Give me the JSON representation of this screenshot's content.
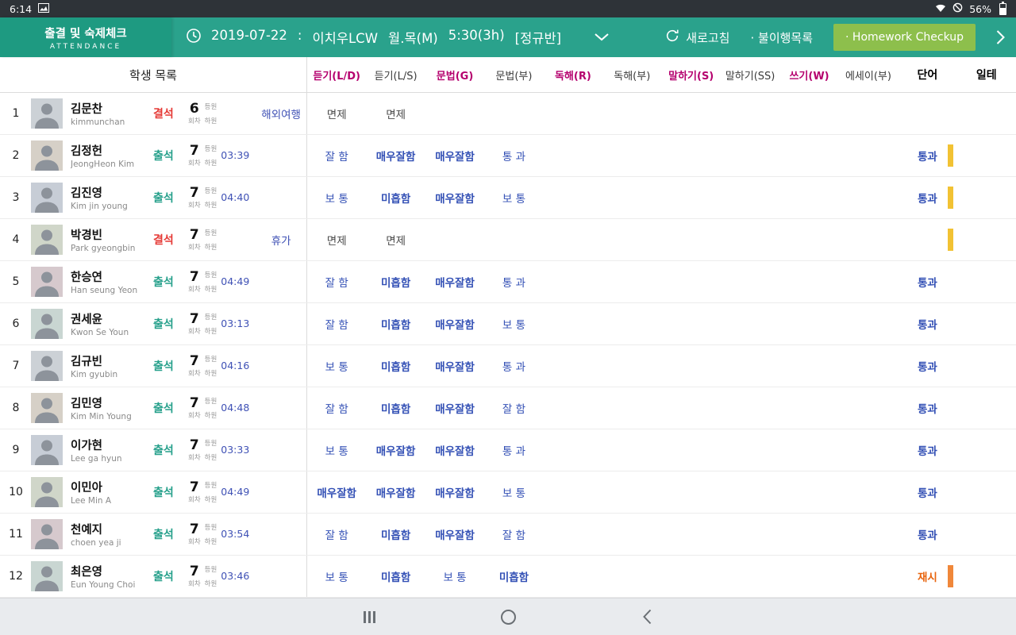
{
  "colors": {
    "header_teal": "#2aa28c",
    "header_teal_dark": "#1e9a81",
    "column_accent_magenta": "#b5006e",
    "grade_value_blue": "#3350b5",
    "present_teal": "#26a08b",
    "absent_red": "#e53935",
    "retry_orange": "#e8650f",
    "indicator_yellow": "#f2c233",
    "indicator_orange": "#f0873a",
    "homework_button_green": "#8dbf4c"
  },
  "status_bar": {
    "time": "6:14",
    "battery_percent": "56%"
  },
  "header": {
    "title": "출결 및 숙제체크",
    "subtitle": "ATTENDANCE",
    "session_parts": [
      "2019-07-22",
      ":",
      "이치우LCW",
      "월.목(M)",
      "5:30(3h)",
      "[정규반]"
    ],
    "refresh_label": "새로고침",
    "noncompliance_label": "· 불이행목록",
    "homework_button_label": "· Homework Checkup"
  },
  "table": {
    "student_list_header": "학생 목록",
    "count_unit": "회차",
    "in_label": "등원",
    "out_label": "하원",
    "columns": [
      {
        "label": "듣기(L/D)",
        "style": "accent"
      },
      {
        "label": "듣기(L/S)",
        "style": "muted"
      },
      {
        "label": "문법(G)",
        "style": "accent"
      },
      {
        "label": "문법(부)",
        "style": "muted"
      },
      {
        "label": "독해(R)",
        "style": "accent"
      },
      {
        "label": "독해(부)",
        "style": "muted"
      },
      {
        "label": "말하기(S)",
        "style": "accent"
      },
      {
        "label": "말하기(SS)",
        "style": "muted"
      },
      {
        "label": "쓰기(W)",
        "style": "accent"
      },
      {
        "label": "에세이(부)",
        "style": "muted"
      },
      {
        "label": "단어",
        "style": "strong"
      },
      {
        "label": "일테",
        "style": "strong"
      }
    ],
    "rows": [
      {
        "no": "1",
        "name": "김문찬",
        "roman": "kimmunchan",
        "status": "결석",
        "status_type": "absent",
        "count": "6",
        "in_time": "",
        "memo": "해외여행",
        "grades": [
          "면제",
          "면제",
          "",
          "",
          "",
          "",
          "",
          "",
          "",
          ""
        ],
        "vocab": "",
        "bar": ""
      },
      {
        "no": "2",
        "name": "김정헌",
        "roman": "JeongHeon Kim",
        "status": "출석",
        "status_type": "present",
        "count": "7",
        "in_time": "03:39",
        "memo": "",
        "grades": [
          "잘 함",
          "매우잘함",
          "매우잘함",
          "통 과",
          "",
          "",
          "",
          "",
          "",
          ""
        ],
        "vocab": "통과",
        "bar": "yellow"
      },
      {
        "no": "3",
        "name": "김진영",
        "roman": "Kim jin young",
        "status": "출석",
        "status_type": "present",
        "count": "7",
        "in_time": "04:40",
        "memo": "",
        "grades": [
          "보 통",
          "미흡함",
          "매우잘함",
          "보 통",
          "",
          "",
          "",
          "",
          "",
          ""
        ],
        "vocab": "통과",
        "bar": "yellow"
      },
      {
        "no": "4",
        "name": "박경빈",
        "roman": "Park gyeongbin",
        "status": "결석",
        "status_type": "absent",
        "count": "7",
        "in_time": "",
        "memo": "휴가",
        "grades": [
          "면제",
          "면제",
          "",
          "",
          "",
          "",
          "",
          "",
          "",
          ""
        ],
        "vocab": "",
        "bar": "yellow"
      },
      {
        "no": "5",
        "name": "한승연",
        "roman": "Han seung Yeon",
        "status": "출석",
        "status_type": "present",
        "count": "7",
        "in_time": "04:49",
        "memo": "",
        "grades": [
          "잘 함",
          "미흡함",
          "매우잘함",
          "통 과",
          "",
          "",
          "",
          "",
          "",
          ""
        ],
        "vocab": "통과",
        "bar": ""
      },
      {
        "no": "6",
        "name": "권세윤",
        "roman": "Kwon Se Youn",
        "status": "출석",
        "status_type": "present",
        "count": "7",
        "in_time": "03:13",
        "memo": "",
        "grades": [
          "잘 함",
          "미흡함",
          "매우잘함",
          "보 통",
          "",
          "",
          "",
          "",
          "",
          ""
        ],
        "vocab": "통과",
        "bar": ""
      },
      {
        "no": "7",
        "name": "김규빈",
        "roman": "Kim gyubin",
        "status": "출석",
        "status_type": "present",
        "count": "7",
        "in_time": "04:16",
        "memo": "",
        "grades": [
          "보 통",
          "미흡함",
          "매우잘함",
          "통 과",
          "",
          "",
          "",
          "",
          "",
          ""
        ],
        "vocab": "통과",
        "bar": ""
      },
      {
        "no": "8",
        "name": "김민영",
        "roman": "Kim Min Young",
        "status": "출석",
        "status_type": "present",
        "count": "7",
        "in_time": "04:48",
        "memo": "",
        "grades": [
          "잘 함",
          "미흡함",
          "매우잘함",
          "잘 함",
          "",
          "",
          "",
          "",
          "",
          ""
        ],
        "vocab": "통과",
        "bar": ""
      },
      {
        "no": "9",
        "name": "이가현",
        "roman": "Lee ga hyun",
        "status": "출석",
        "status_type": "present",
        "count": "7",
        "in_time": "03:33",
        "memo": "",
        "grades": [
          "보 통",
          "매우잘함",
          "매우잘함",
          "통 과",
          "",
          "",
          "",
          "",
          "",
          ""
        ],
        "vocab": "통과",
        "bar": ""
      },
      {
        "no": "10",
        "name": "이민아",
        "roman": "Lee Min A",
        "status": "출석",
        "status_type": "present",
        "count": "7",
        "in_time": "04:49",
        "memo": "",
        "grades": [
          "매우잘함",
          "매우잘함",
          "매우잘함",
          "보 통",
          "",
          "",
          "",
          "",
          "",
          ""
        ],
        "vocab": "통과",
        "bar": ""
      },
      {
        "no": "11",
        "name": "천예지",
        "roman": "choen yea ji",
        "status": "출석",
        "status_type": "present",
        "count": "7",
        "in_time": "03:54",
        "memo": "",
        "grades": [
          "잘 함",
          "미흡함",
          "매우잘함",
          "잘 함",
          "",
          "",
          "",
          "",
          "",
          ""
        ],
        "vocab": "통과",
        "bar": ""
      },
      {
        "no": "12",
        "name": "최은영",
        "roman": "Eun Young Choi",
        "status": "출석",
        "status_type": "present",
        "count": "7",
        "in_time": "03:46",
        "memo": "",
        "grades": [
          "보 통",
          "미흡함",
          "보 통",
          "미흡함",
          "",
          "",
          "",
          "",
          "",
          ""
        ],
        "vocab": "재시",
        "bar": "orange"
      }
    ]
  }
}
